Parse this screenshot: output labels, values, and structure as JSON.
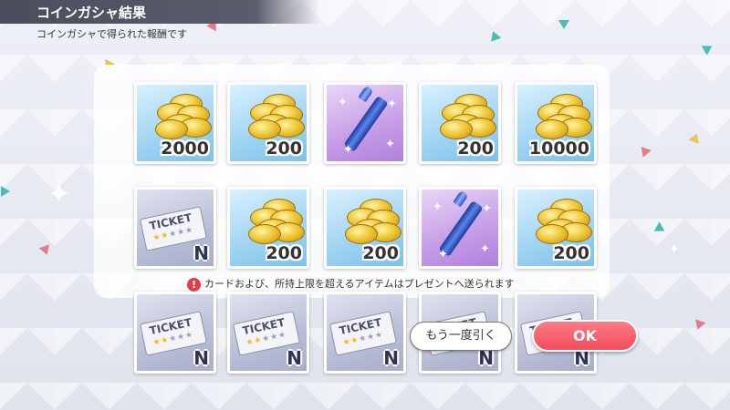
{
  "header": {
    "title": "コインガシャ結果",
    "subtitle": "コインガシャで得られた報酬です"
  },
  "rewards": [
    {
      "type": "coin",
      "amount": "2000"
    },
    {
      "type": "coin",
      "amount": "200"
    },
    {
      "type": "lipstick",
      "amount": ""
    },
    {
      "type": "coin",
      "amount": "200"
    },
    {
      "type": "coin",
      "amount": "10000"
    },
    {
      "type": "ticket",
      "ticket_label": "TICKET",
      "rarity": "N"
    },
    {
      "type": "coin",
      "amount": "200"
    },
    {
      "type": "coin",
      "amount": "200"
    },
    {
      "type": "lipstick",
      "amount": ""
    },
    {
      "type": "coin",
      "amount": "200"
    },
    {
      "type": "ticket",
      "ticket_label": "TICKET",
      "rarity": "N"
    },
    {
      "type": "ticket",
      "ticket_label": "TICKET",
      "rarity": "N"
    },
    {
      "type": "ticket",
      "ticket_label": "TICKET",
      "rarity": "N"
    },
    {
      "type": "ticket",
      "ticket_label": "TICKET",
      "rarity": "N"
    },
    {
      "type": "ticket",
      "ticket_label": "TICKET",
      "rarity": "N"
    }
  ],
  "notice": {
    "icon": "exclamation-icon",
    "text": "カードおよび、所持上限を超えるアイテムはプレゼントへ送られます"
  },
  "buttons": {
    "retry_label": "もう一度引く",
    "ok_label": "OK"
  },
  "colors": {
    "ok_button": "#f04d5b",
    "notice_icon": "#e33b4a",
    "title_bar": "#4a4d5c"
  }
}
